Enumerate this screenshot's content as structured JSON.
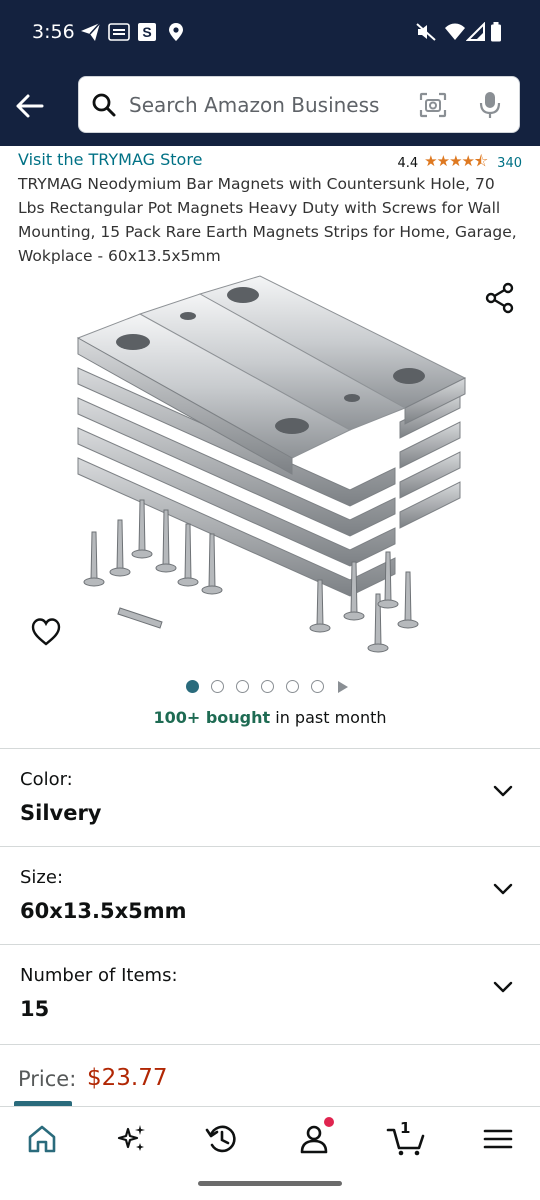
{
  "status_bar": {
    "time": "3:56",
    "icons": [
      "telegram-icon",
      "temu-icon",
      "s-app-icon",
      "location-icon",
      "mute-icon",
      "wifi-icon",
      "signal-icon",
      "battery-icon"
    ]
  },
  "header": {
    "search_placeholder": "Search Amazon Business",
    "back_icon": "arrow-left-icon"
  },
  "product": {
    "store_link": "Visit the TRYMAG Store",
    "rating": "4.4",
    "stars": "★★★★⯪",
    "rating_count": "340",
    "title": "TRYMAG Neodymium Bar Magnets with Countersunk Hole, 70 Lbs Rectangular Pot Magnets Heavy Duty with Screws for Wall Mounting, 15 Pack Rare Earth Magnets Strips for Home, Garage, Wokplace - 60x13.5x5mm",
    "image_count": 6,
    "active_image": 1,
    "bought_strong": "100+ bought",
    "bought_rest": " in past month"
  },
  "options": [
    {
      "label": "Color:",
      "value": "Silvery"
    },
    {
      "label": "Size:",
      "value": "60x13.5x5mm"
    },
    {
      "label": "Number of Items:",
      "value": "15"
    }
  ],
  "price": {
    "label": "Price:",
    "value": "$23.77"
  },
  "bottom_nav": {
    "items": [
      "home-icon",
      "ai-sparkle-icon",
      "reorder-icon",
      "account-icon",
      "cart-icon",
      "menu-icon"
    ],
    "cart_count": "1"
  },
  "colors": {
    "header_bg": "#14223f",
    "link": "#007185",
    "star": "#de7921",
    "price": "#b12704",
    "bought": "#1e6b53",
    "accent": "#2a6b7c"
  }
}
